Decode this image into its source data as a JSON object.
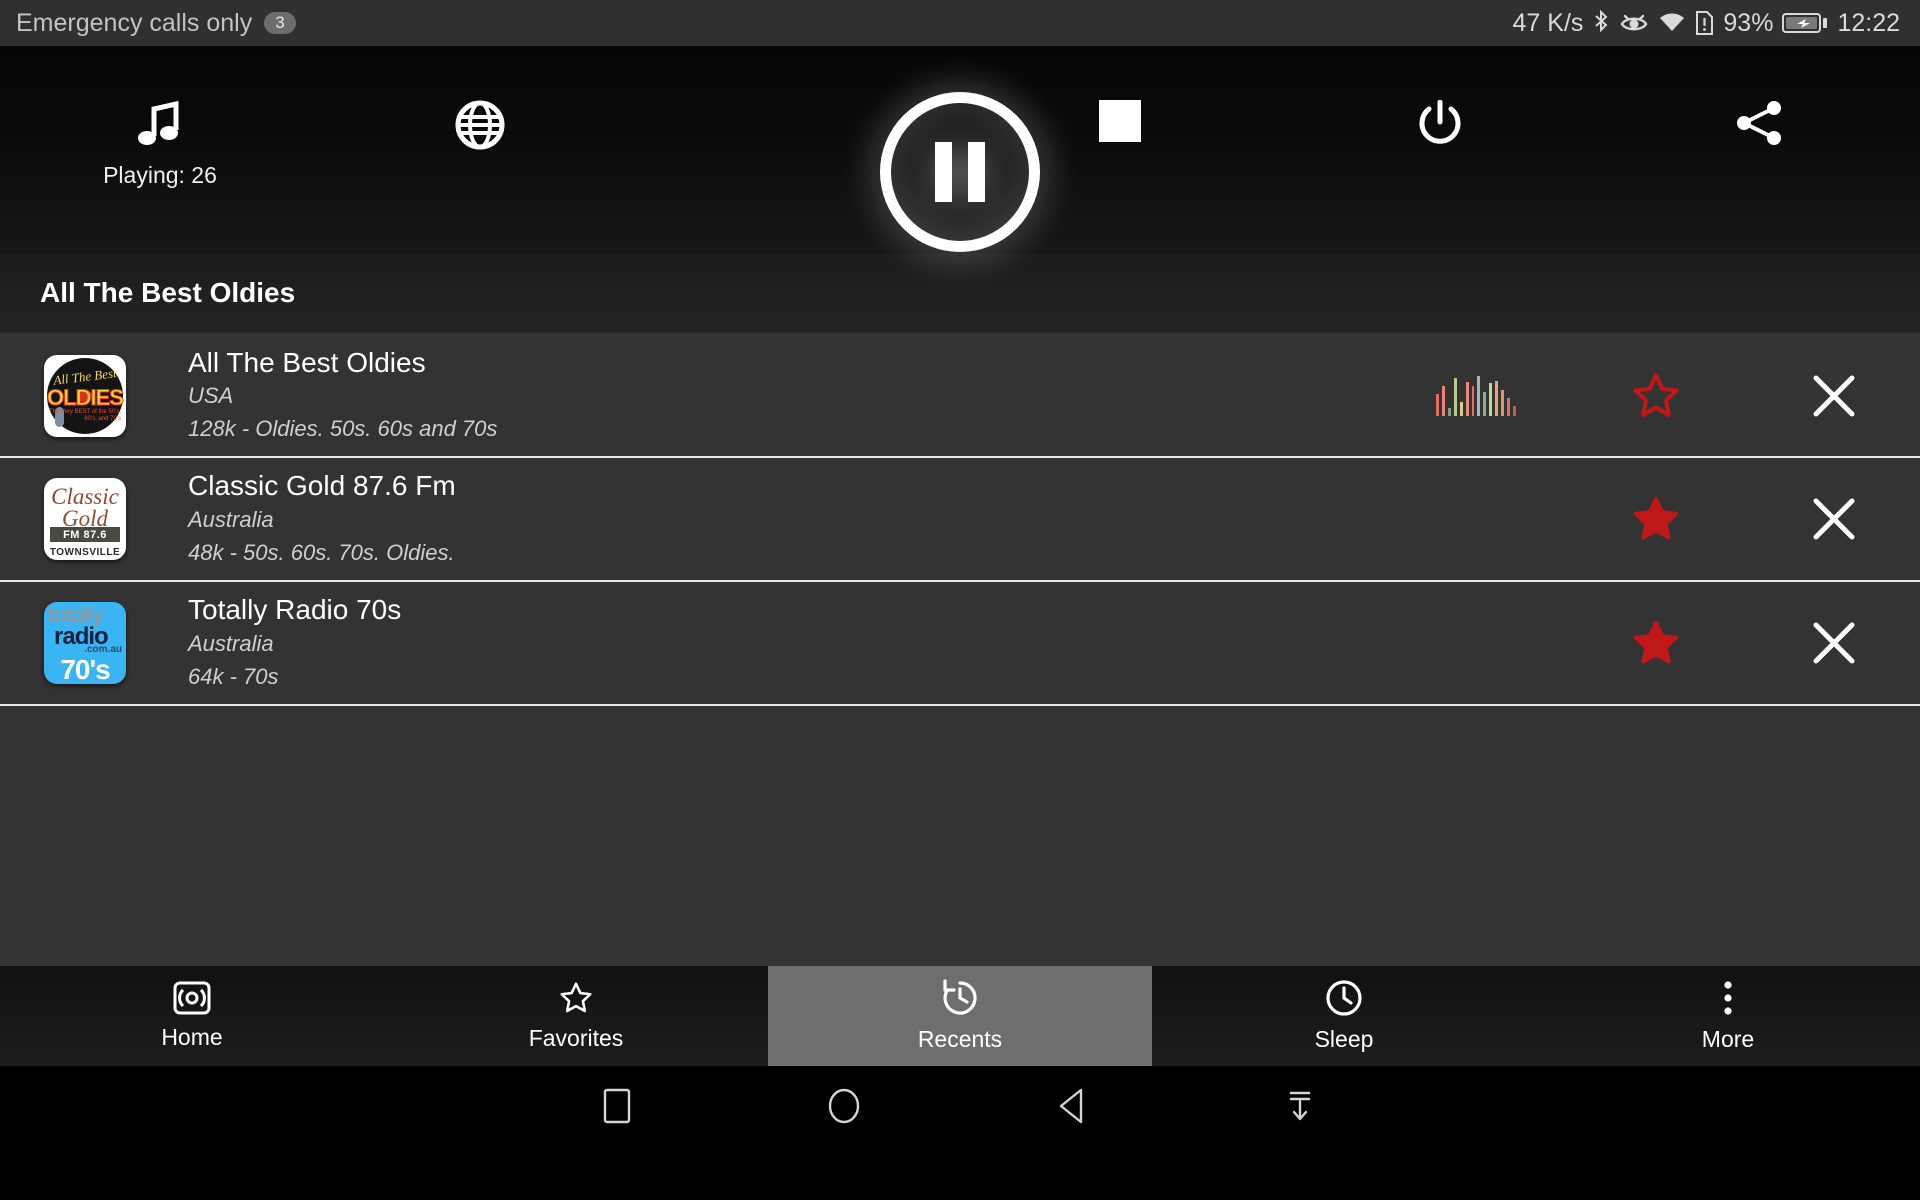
{
  "statusbar": {
    "carrier": "Emergency calls only",
    "notif_count": "3",
    "network_speed": "47 K/s",
    "battery_pct": "93%",
    "clock": "12:22",
    "icons": [
      "bluetooth-icon",
      "eye-icon",
      "wifi-icon",
      "sim-alert-icon",
      "battery-charging-icon"
    ]
  },
  "player": {
    "music_icon": "music-note-icon",
    "playing_label": "Playing: 26",
    "globe_icon": "globe-icon",
    "pause_icon": "pause-icon",
    "stop_icon": "stop-icon",
    "power_icon": "power-icon",
    "share_icon": "share-icon"
  },
  "header": {
    "title": "All The Best Oldies"
  },
  "list": {
    "rows": [
      {
        "name": "All The Best Oldies",
        "country": "USA",
        "details": "128k - Oldies. 50s. 60s and 70s",
        "logo": "all-the-best-oldies-logo",
        "logo_text": {
          "script": "All The Best",
          "word": "OLDIES",
          "tag": "The Very BEST\nof the 50's, 60's, and 70's"
        },
        "favorite": false,
        "equalizer": true,
        "close_icon": "close-icon"
      },
      {
        "name": "Classic Gold 87.6 Fm",
        "country": "Australia",
        "details": "48k - 50s. 60s. 70s. Oldies.",
        "logo": "classic-gold-logo",
        "logo_text": {
          "line1": "Classic",
          "line2": "Gold",
          "band": "FM 87.6",
          "town": "TOWNSVILLE"
        },
        "favorite": true,
        "equalizer": false,
        "close_icon": "close-icon"
      },
      {
        "name": "Totally Radio 70s",
        "country": "Australia",
        "details": "64k - 70s",
        "logo": "totally-radio-logo",
        "logo_text": {
          "t1": "totally",
          "t2": "radio",
          "t3": ".com.au",
          "t4": "70's"
        },
        "favorite": true,
        "equalizer": false,
        "close_icon": "close-icon"
      }
    ],
    "equalizer_colors": [
      "#e0705f",
      "#e8857a",
      "#7f9d86",
      "#b9c98f",
      "#d9c98e",
      "#e58a7d",
      "#e0705f",
      "#9bbcb4",
      "#8fa98c",
      "#c8d49a",
      "#e9a36d",
      "#e0956b",
      "#d9736a",
      "#c45a4d"
    ],
    "equalizer_heights": [
      22,
      30,
      8,
      38,
      14,
      34,
      30,
      40,
      24,
      33,
      35,
      26,
      18,
      10
    ]
  },
  "nav": {
    "items": [
      {
        "label": "Home",
        "icon": "broadcast-icon",
        "active": false
      },
      {
        "label": "Favorites",
        "icon": "star-outline-icon",
        "active": false
      },
      {
        "label": "Recents",
        "icon": "history-icon",
        "active": true
      },
      {
        "label": "Sleep",
        "icon": "clock-icon",
        "active": false
      },
      {
        "label": "More",
        "icon": "overflow-dots-icon",
        "active": false
      }
    ]
  },
  "sysbar": {
    "icons": [
      "recents-square-icon",
      "home-circle-icon",
      "back-triangle-icon",
      "hide-nav-icon"
    ]
  },
  "colors": {
    "star": "#c01818",
    "accent": "#ffffff",
    "list_bg": "#333333",
    "nav_active": "#6e6e6e"
  }
}
